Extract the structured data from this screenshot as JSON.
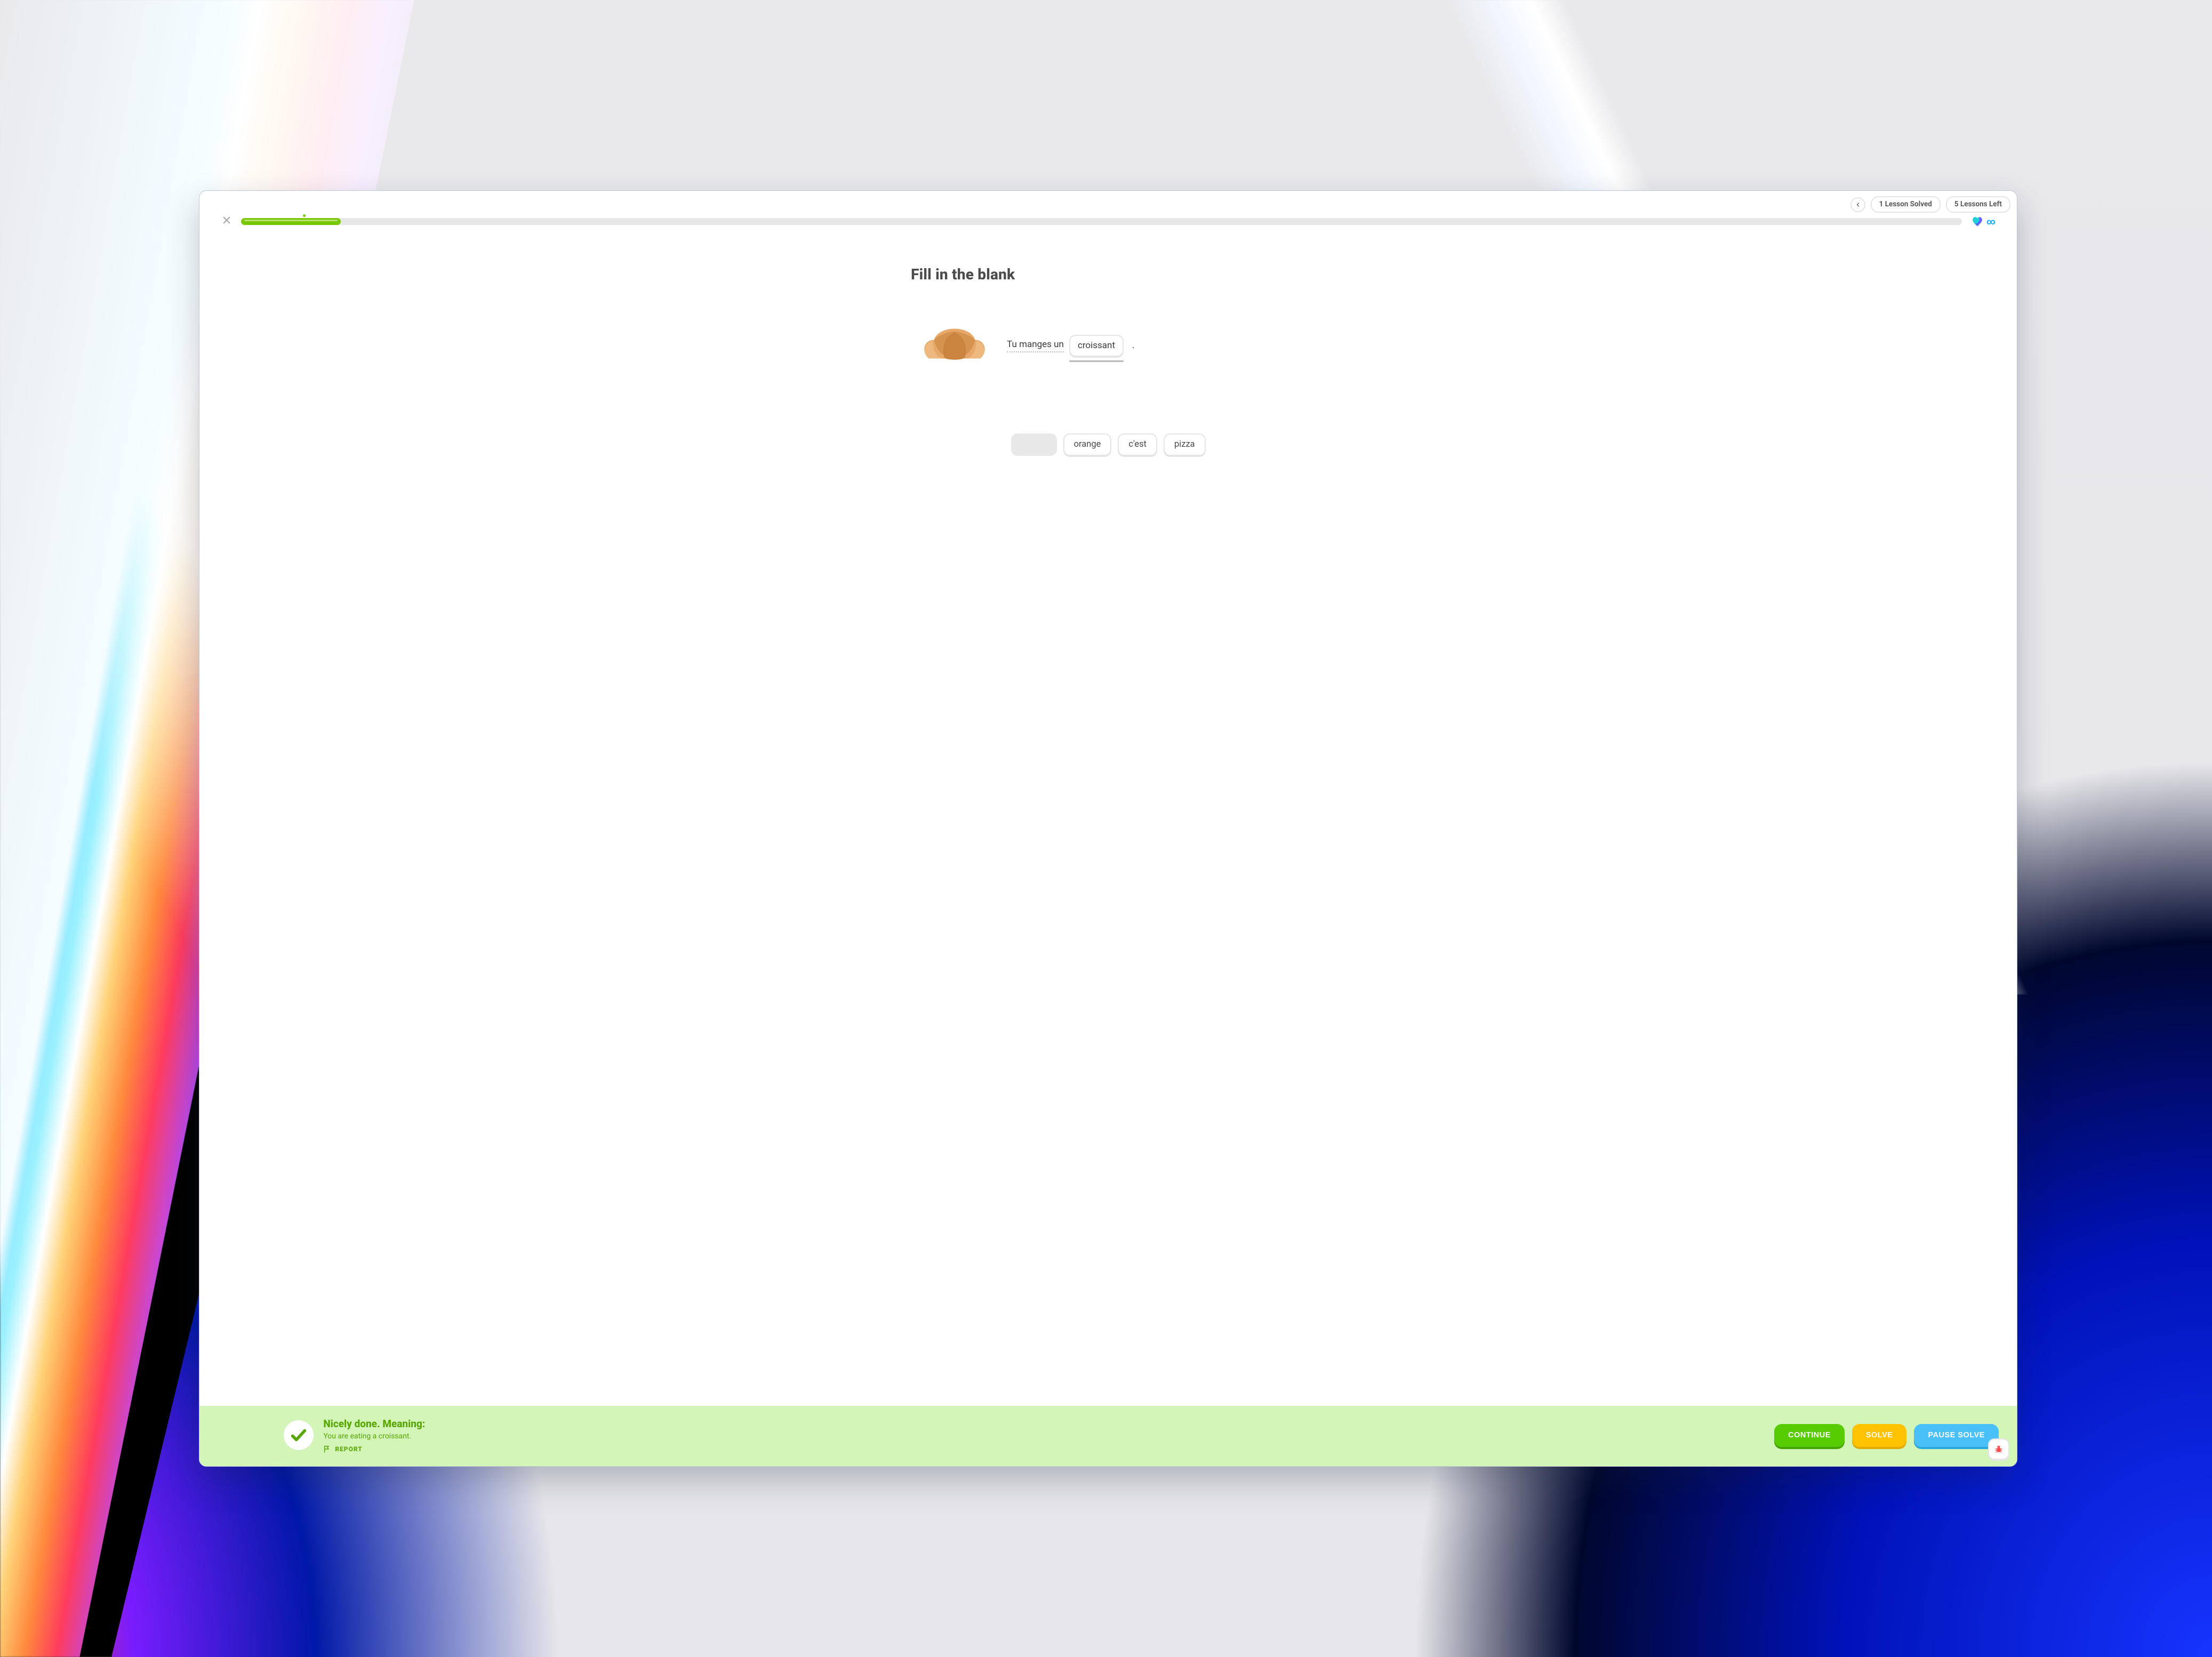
{
  "status": {
    "solved_label": "1 Lesson Solved",
    "left_label": "5 Lessons Left"
  },
  "progress": {
    "percent": 5.8,
    "lives_icon": "infinity"
  },
  "question": {
    "title": "Fill in the blank",
    "image": "croissant",
    "sentence_prefix": "Tu manges un",
    "filled_answer": "croissant",
    "sentence_suffix": "."
  },
  "options": [
    {
      "label": "",
      "used": true
    },
    {
      "label": "orange",
      "used": false
    },
    {
      "label": "c'est",
      "used": false
    },
    {
      "label": "pizza",
      "used": false
    }
  ],
  "feedback": {
    "title": "Nicely done. Meaning:",
    "meaning": "You are eating a croissant.",
    "report_label": "REPORT"
  },
  "buttons": {
    "continue": "CONTINUE",
    "solve": "SOLVE",
    "pause_solve": "PAUSE SOLVE"
  }
}
